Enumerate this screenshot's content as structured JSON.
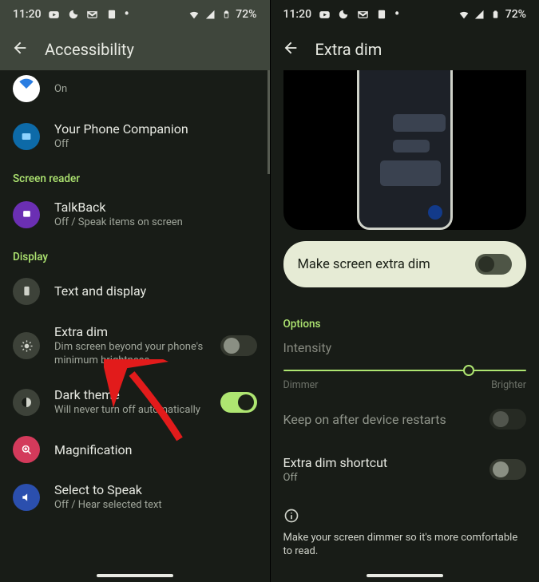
{
  "status": {
    "time": "11:20",
    "battery": "72%"
  },
  "left": {
    "title": "Accessibility",
    "partialTop": {
      "sub": "On"
    },
    "items": [
      {
        "id": "your-phone",
        "title": "Your Phone Companion",
        "sub": "Off",
        "iconBg": "#0d6aa8",
        "iconFg": "#8ed3ff"
      },
      {
        "section": "Screen reader"
      },
      {
        "id": "talkback",
        "title": "TalkBack",
        "sub": "Off / Speak items on screen",
        "iconBg": "#6b2fb3",
        "iconFg": "#fff"
      },
      {
        "section": "Display"
      },
      {
        "id": "text-display",
        "title": "Text and display",
        "iconBg": "#3d4239",
        "iconFg": "#cfd2c9"
      },
      {
        "id": "extra-dim",
        "title": "Extra dim",
        "sub": "Dim screen beyond your phone's minimum brightness",
        "iconBg": "#3d4239",
        "iconFg": "#cfd2c9",
        "toggle": "off"
      },
      {
        "id": "dark-theme",
        "title": "Dark theme",
        "sub": "Will never turn off automatically",
        "iconBg": "#3d4239",
        "iconFg": "#cfd2c9",
        "toggle": "on"
      },
      {
        "id": "magnification",
        "title": "Magnification",
        "iconBg": "#d33a5b",
        "iconFg": "#fff"
      },
      {
        "id": "select-to-speak",
        "title": "Select to Speak",
        "sub": "Off / Hear selected text",
        "iconBg": "#2b4fae",
        "iconFg": "#fff"
      }
    ]
  },
  "right": {
    "title": "Extra dim",
    "mainToggleLabel": "Make screen extra dim",
    "optionsLabel": "Options",
    "intensityLabel": "Intensity",
    "dimmerLabel": "Dimmer",
    "brighterLabel": "Brighter",
    "keepOnLabel": "Keep on after device restarts",
    "shortcutTitle": "Extra dim shortcut",
    "shortcutSub": "Off",
    "footText": "Make your screen dimmer so it's more comfortable to read."
  }
}
